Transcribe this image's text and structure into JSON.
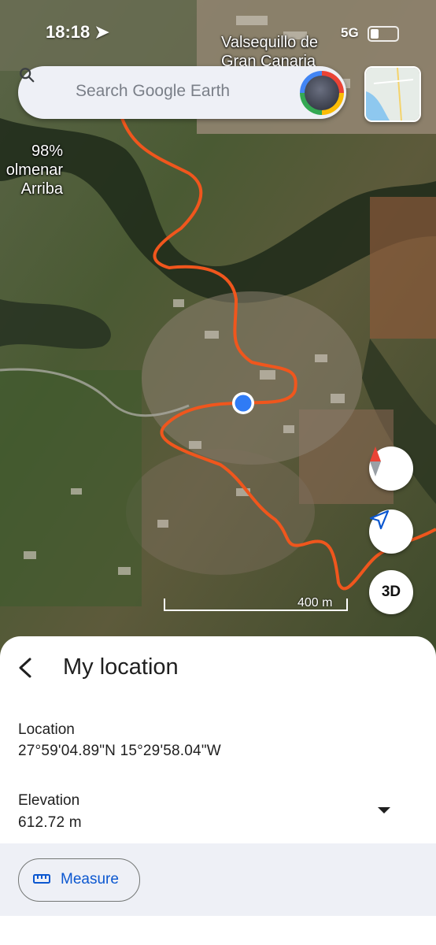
{
  "status_bar": {
    "time": "18:18",
    "network": "5G"
  },
  "map": {
    "place_labels": [
      {
        "id": "valsequillo",
        "text": "Valsequillo de\nGran Canaria"
      },
      {
        "id": "colmenar",
        "text": "98%\nolmenar\nArriba"
      }
    ],
    "scale_label": "400 m",
    "route_color": "#f0561d",
    "location_dot_color": "#2f7bf5"
  },
  "search": {
    "placeholder": "Search Google Earth"
  },
  "controls": {
    "three_d_label": "3D"
  },
  "sheet": {
    "title": "My location",
    "location_label": "Location",
    "location_value": "27°59'04.89\"N 15°29'58.04\"W",
    "elevation_label": "Elevation",
    "elevation_value": "612.72 m",
    "measure_label": "Measure"
  }
}
